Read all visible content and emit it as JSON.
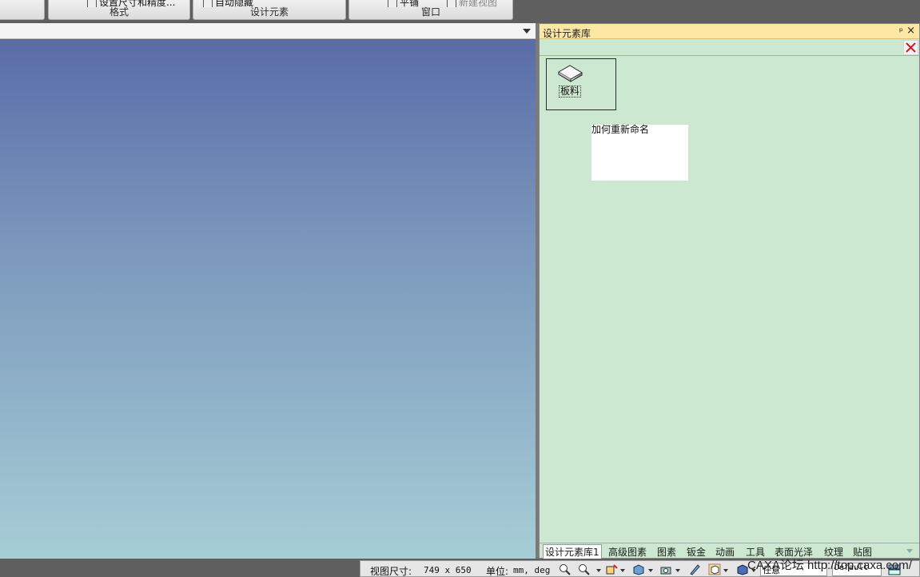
{
  "ribbon": {
    "groups": [
      {
        "title": "",
        "items": []
      },
      {
        "title": "格式",
        "items": [
          "设置尺寸和精度..."
        ]
      },
      {
        "title": "设计元素",
        "items": [
          "自动隐藏"
        ]
      },
      {
        "title": "窗口",
        "items": [
          "平铺",
          "新建视图"
        ]
      }
    ]
  },
  "library": {
    "title": "设计元素库",
    "pin_glyph": "ᵖ",
    "close_glyph": "×",
    "item": {
      "label": "板料"
    },
    "rename_text": "加何重新命名",
    "tabs": [
      "设计元素库1",
      "高级图素",
      "图素",
      "钣金",
      "动画",
      "工具",
      "表面光泽",
      "纹理",
      "贴图"
    ]
  },
  "status": {
    "view_size_label": "视图尺寸:",
    "view_size_value": "749 x  650",
    "unit_label": "单位:",
    "unit_value": "mm, deg",
    "snap_value": "任意",
    "style_value": "Default"
  },
  "watermark": "CAXA论坛 http://top.caxa.com/",
  "colors": {
    "panel_bg": "#cde8d0",
    "panel_header": "#fde7a5",
    "viewport_top": "#5a6ca8",
    "viewport_bottom": "#a6ced6",
    "delete_red": "#d21a1a"
  }
}
